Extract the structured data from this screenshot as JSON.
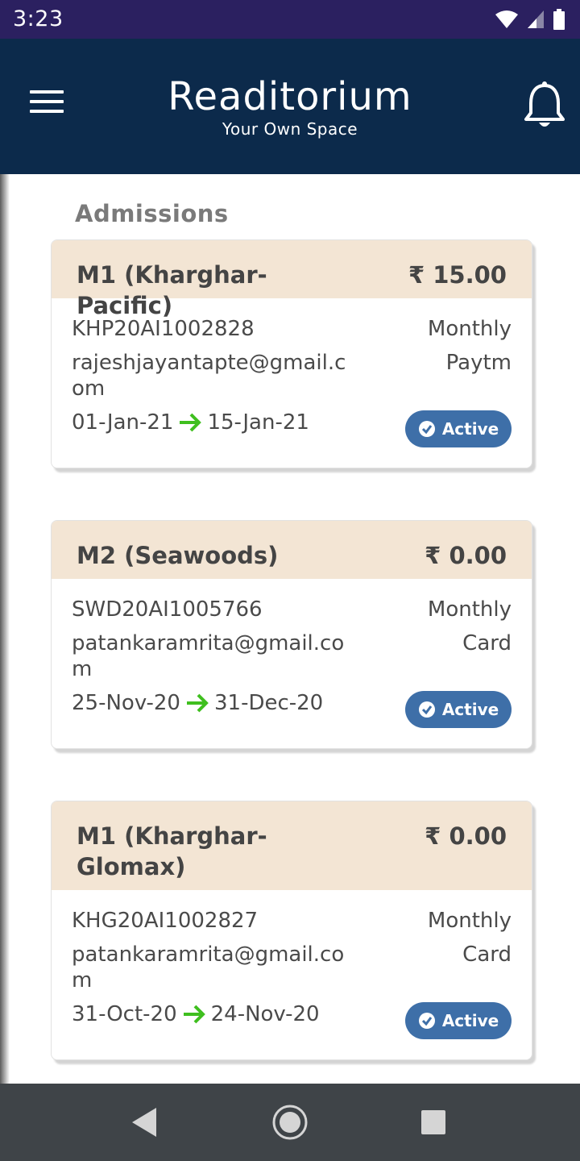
{
  "status_bar": {
    "time": "3:23",
    "icons": [
      "wifi-icon",
      "signal-icon",
      "battery-icon"
    ]
  },
  "header": {
    "title": "Readitorium",
    "subtitle": "Your Own Space",
    "menu_icon": "menu-icon",
    "notification_icon": "bell-icon"
  },
  "section": {
    "title": "Admissions"
  },
  "admissions": [
    {
      "name": "M1 (Kharghar-Pacific)",
      "amount": "₹ 15.00",
      "id": "KHP20AI1002828",
      "email": "rajeshjayantapte@gmail.com",
      "start": "01-Jan-21",
      "end": "15-Jan-21",
      "plan": "Monthly",
      "payment": "Paytm",
      "status": "Active"
    },
    {
      "name": "M2 (Seawoods)",
      "amount": "₹ 0.00",
      "id": "SWD20AI1005766",
      "email": "patankaramrita@gmail.com",
      "start": "25-Nov-20",
      "end": "31-Dec-20",
      "plan": "Monthly",
      "payment": "Card",
      "status": "Active"
    },
    {
      "name": "M1 (Kharghar-Glomax)",
      "amount": "₹ 0.00",
      "id": "KHG20AI1002827",
      "email": "patankaramrita@gmail.com",
      "start": "31-Oct-20",
      "end": "24-Nov-20",
      "plan": "Monthly",
      "payment": "Card",
      "status": "Active"
    }
  ],
  "colors": {
    "status_bar": "#2b2060",
    "header": "#0c2a4b",
    "card_header": "#f3e5d4",
    "badge": "#3e6fa8",
    "arrow": "#3fbf1f",
    "nav_bar": "#3f4448"
  },
  "nav": {
    "icons": [
      "back-icon",
      "home-icon",
      "recents-icon"
    ]
  }
}
